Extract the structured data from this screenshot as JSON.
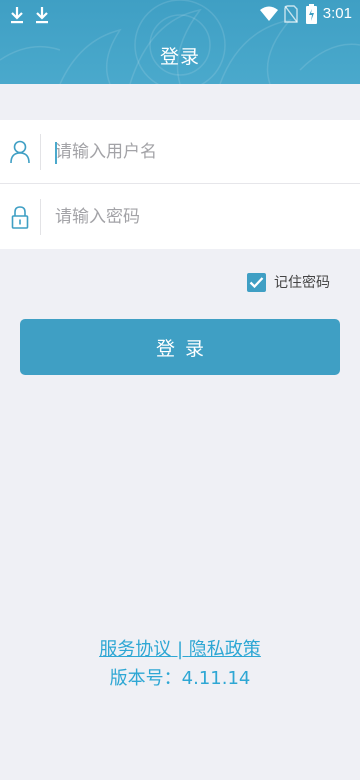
{
  "status_bar": {
    "time": "3:01",
    "icons": [
      "download-icon",
      "download-icon",
      "wifi-icon",
      "no-sim-icon",
      "battery-charging-icon"
    ]
  },
  "header": {
    "title": "登录"
  },
  "form": {
    "username_placeholder": "请输入用户名",
    "username_value": "",
    "password_placeholder": "请输入密码",
    "password_value": ""
  },
  "remember": {
    "label": "记住密码",
    "checked": true
  },
  "login_button": {
    "label": "登录"
  },
  "footer": {
    "service_agreement": "服务协议",
    "separator": " | ",
    "privacy_policy": "隐私政策",
    "version_text": "版本号：4.11.14"
  },
  "colors": {
    "primary": "#3f9fc4",
    "link": "#2ea7d4",
    "background": "#eff0f5"
  }
}
